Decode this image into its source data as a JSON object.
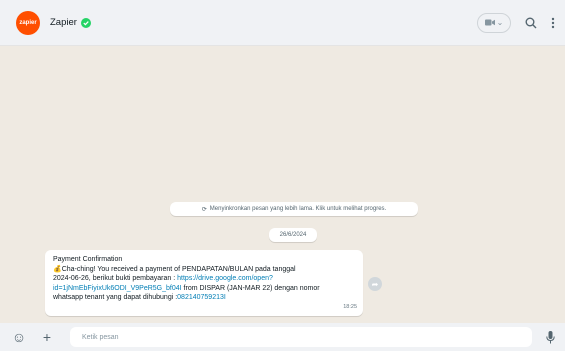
{
  "header": {
    "avatar_text": "zapier",
    "contact_name": "Zapier",
    "accent": "#ff4f00",
    "verified_color": "#25d366",
    "icons": [
      "video-call-icon",
      "search-icon",
      "menu-icon"
    ]
  },
  "chat": {
    "sync_notice": "Menyinkronkan pesan yang lebih lama. Klik untuk melihat progres.",
    "date_divider": "26/6/2024",
    "message": {
      "line1": "Payment Confirmation",
      "line2": "Cha-ching! You received a payment of PENDAPATAN/BULAN pada tanggal",
      "line3_prefix": "2024-06-26, berikut bukti pembayaran : ",
      "url_part1": "https://drive.google.com/open?",
      "url_part2": "id=1jNmEbFiyixUk6ODI_V9PeR5G_bf04I",
      "line4_suffix": " from DISPAR (JAN-MAR 22)  dengan nomor",
      "line5_prefix": "whatsapp tenant yang dapat dihubungi :",
      "phone": "082140759213I",
      "time": "18:25"
    }
  },
  "footer": {
    "placeholder": "Ketik pesan",
    "icons": [
      "emoji-icon",
      "attach-plus-icon",
      "microphone-icon"
    ]
  }
}
